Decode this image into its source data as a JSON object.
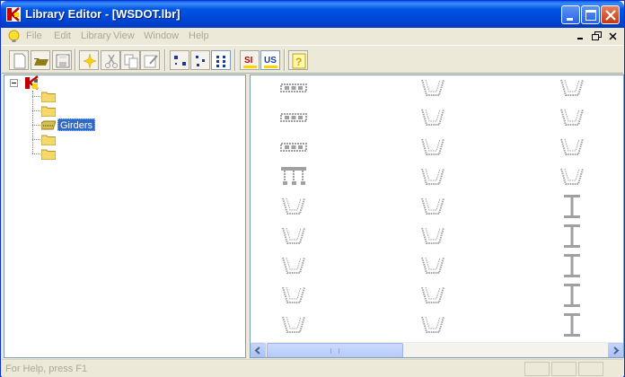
{
  "window": {
    "title": "Library Editor - [WSDOT.lbr]"
  },
  "menu": {
    "items": [
      "File",
      "Edit",
      "Library",
      "View",
      "Window",
      "Help"
    ]
  },
  "toolbar": {
    "buttons": [
      "new-file",
      "open-file",
      "save",
      "new-entry",
      "cut",
      "copy",
      "edit",
      "large-icons",
      "small-icons",
      "list-view",
      "si-units",
      "us-units",
      "help"
    ],
    "si_label": "SI",
    "us_label": "US",
    "active_view": "list-view",
    "active_units": "US"
  },
  "tree": {
    "root_icon": "library-icon",
    "children": [
      {
        "label": "",
        "icon": "folder-icon"
      },
      {
        "label": "",
        "icon": "folder-icon"
      },
      {
        "label": "Girders",
        "icon": "girder-folder-icon",
        "selected": true
      },
      {
        "label": "",
        "icon": "folder-icon"
      },
      {
        "label": "",
        "icon": "folder-icon"
      }
    ]
  },
  "icon_grid": {
    "columns": [
      [
        "box-beam",
        "box-beam",
        "box-beam",
        "deck-bulb-tee",
        "u-beam",
        "u-beam",
        "u-beam",
        "u-beam",
        "u-beam"
      ],
      [
        "u-beam",
        "u-beam",
        "u-beam",
        "u-beam",
        "u-beam",
        "u-beam",
        "u-beam",
        "u-beam",
        "u-beam"
      ],
      [
        "u-beam",
        "u-beam",
        "u-beam",
        "u-beam",
        "i-beam",
        "i-beam",
        "i-beam",
        "i-beam",
        "i-beam"
      ]
    ]
  },
  "statusbar": {
    "text": "For Help, press F1"
  },
  "colors": {
    "titlebar": "#0055e5",
    "selection": "#316ac5",
    "icon_gray": "#a0a0a0"
  }
}
